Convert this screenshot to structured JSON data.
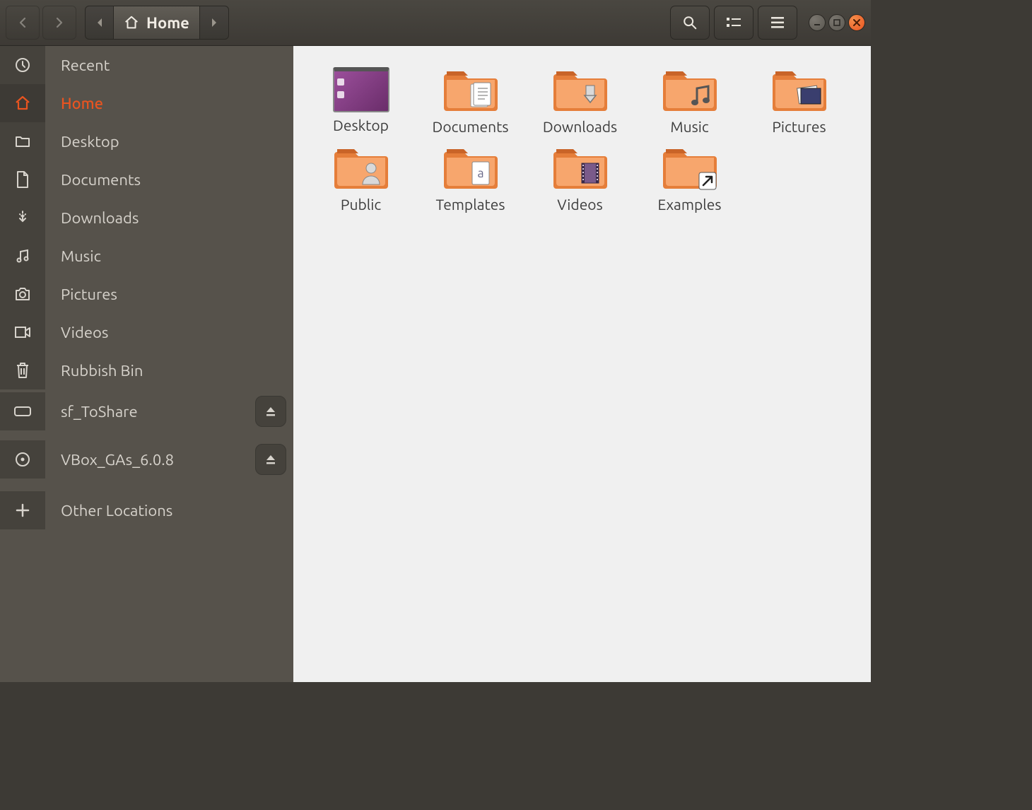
{
  "path": {
    "current": "Home"
  },
  "sidebar": {
    "items": [
      {
        "label": "Recent",
        "icon": "clock"
      },
      {
        "label": "Home",
        "icon": "home",
        "active": true
      },
      {
        "label": "Desktop",
        "icon": "folder"
      },
      {
        "label": "Documents",
        "icon": "document"
      },
      {
        "label": "Downloads",
        "icon": "download"
      },
      {
        "label": "Music",
        "icon": "music"
      },
      {
        "label": "Pictures",
        "icon": "camera"
      },
      {
        "label": "Videos",
        "icon": "video"
      },
      {
        "label": "Rubbish Bin",
        "icon": "trash"
      },
      {
        "label": "sf_ToShare",
        "icon": "drive",
        "eject": true
      },
      {
        "label": "VBox_GAs_6.0.8",
        "icon": "disc",
        "eject": true
      },
      {
        "label": "Other Locations",
        "icon": "plus"
      }
    ]
  },
  "content": {
    "items": [
      {
        "label": "Desktop",
        "kind": "desktop"
      },
      {
        "label": "Documents",
        "kind": "folder",
        "overlay": "document"
      },
      {
        "label": "Downloads",
        "kind": "folder",
        "overlay": "download"
      },
      {
        "label": "Music",
        "kind": "folder",
        "overlay": "music"
      },
      {
        "label": "Pictures",
        "kind": "folder",
        "overlay": "pictures"
      },
      {
        "label": "Public",
        "kind": "folder",
        "overlay": "public"
      },
      {
        "label": "Templates",
        "kind": "folder",
        "overlay": "template"
      },
      {
        "label": "Videos",
        "kind": "folder",
        "overlay": "video"
      },
      {
        "label": "Examples",
        "kind": "folder",
        "overlay": "link"
      }
    ]
  }
}
